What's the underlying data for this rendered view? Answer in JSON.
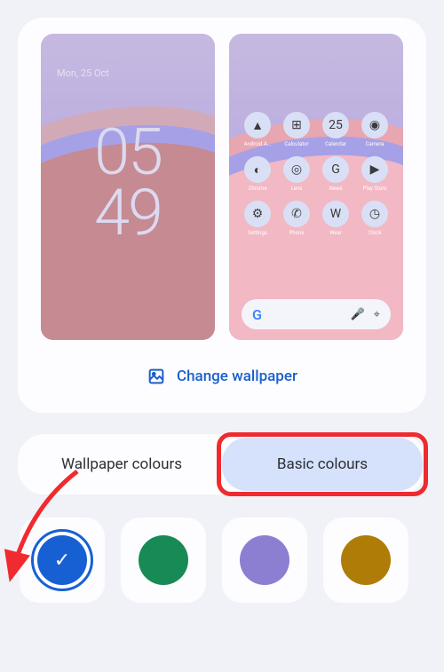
{
  "previews": {
    "lock": {
      "date": "Mon, 25 Oct",
      "time_top": "05",
      "time_bottom": "49"
    },
    "home": {
      "apps": [
        {
          "label": "Android A...",
          "icon": "▲"
        },
        {
          "label": "Calculator",
          "icon": "⊞"
        },
        {
          "label": "Calendar",
          "icon": "25"
        },
        {
          "label": "Camera",
          "icon": "◉"
        },
        {
          "label": "Chrome",
          "icon": "◐"
        },
        {
          "label": "Lens",
          "icon": "◎"
        },
        {
          "label": "News",
          "icon": "G"
        },
        {
          "label": "Play Store",
          "icon": "▶"
        },
        {
          "label": "Settings",
          "icon": "⚙"
        },
        {
          "label": "Phone",
          "icon": "✆"
        },
        {
          "label": "Wear",
          "icon": "W"
        },
        {
          "label": "Clock",
          "icon": "◷"
        }
      ],
      "search_letter": "G"
    }
  },
  "change_wallpaper_label": "Change wallpaper",
  "tabs": {
    "wallpaper": "Wallpaper colours",
    "basic": "Basic colours"
  },
  "swatches": [
    {
      "color": "#1760d4",
      "selected": true
    },
    {
      "color": "#188a55",
      "selected": false
    },
    {
      "color": "#8c7fd1",
      "selected": false
    },
    {
      "color": "#b07c08",
      "selected": false
    }
  ],
  "annotations": {
    "highlight_tab": "basic",
    "arrow_target": "swatch-0"
  }
}
